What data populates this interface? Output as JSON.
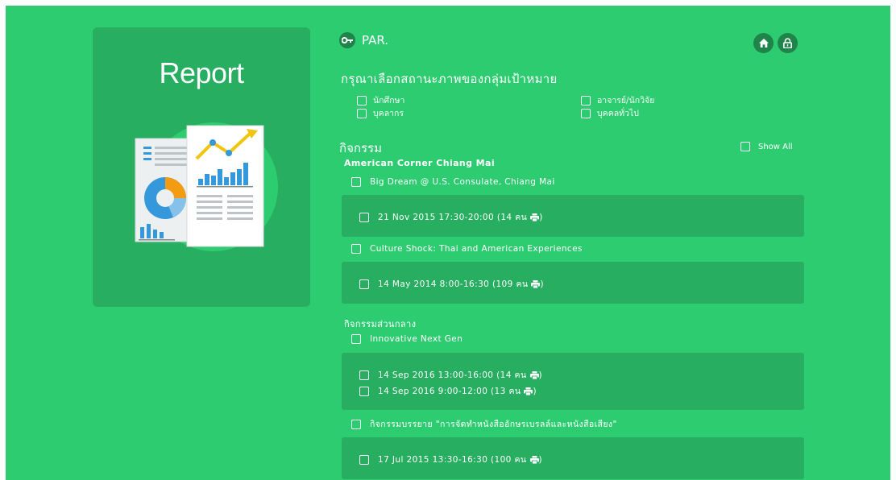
{
  "report_card": {
    "title": "Report"
  },
  "header": {
    "username": "PAR.",
    "home_icon": "home-icon",
    "lock_icon": "lock-icon"
  },
  "target_status": {
    "heading": "กรุณาเลือกสถานะภาพของกลุ่มเป้าหมาย",
    "options": [
      "นักศึกษา",
      "บุคลากร",
      "อาจารย์/นักวิจัย",
      "บุคคลทั่วไป"
    ]
  },
  "activities": {
    "heading": "กิจกรรม",
    "show_all_label": "Show All",
    "groups": [
      {
        "title": "American Corner Chiang Mai",
        "events": [
          {
            "name": "Big Dream @ U.S. Consulate, Chiang Mai",
            "sessions": [
              "21 Nov 2015 17:30-20:00 (14 คน"
            ]
          },
          {
            "name": "Culture Shock: Thai and American Experiences",
            "sessions": [
              "14 May 2014 8:00-16:30 (109 คน"
            ]
          }
        ]
      },
      {
        "title": "กิจกรรมส่วนกลาง",
        "events": [
          {
            "name": "Innovative Next Gen",
            "sessions": [
              "14 Sep 2016 13:00-16:00 (14 คน",
              "14 Sep 2016 9:00-12:00 (13 คน"
            ]
          },
          {
            "name": "กิจกรรมบรรยาย \"การจัดทำหนังสืออักษรเบรลล์และหนังสือเสียง\"",
            "sessions": [
              "17 Jul 2015 13:30-16:30 (100 คน"
            ]
          }
        ]
      }
    ]
  },
  "colors": {
    "background": "#2ecc71",
    "panel": "#27ae60",
    "accent_dark": "#1e8449"
  }
}
